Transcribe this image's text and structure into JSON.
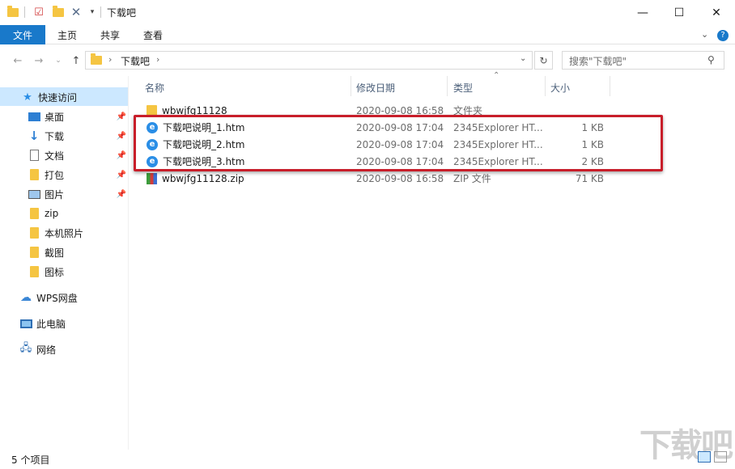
{
  "window": {
    "title": "下载吧",
    "minimize": "—",
    "maximize": "☐",
    "close": "✕"
  },
  "ribbon": {
    "tabs": [
      "文件",
      "主页",
      "共享",
      "查看"
    ],
    "collapse": "⌄",
    "help": "?"
  },
  "address": {
    "path": "下载吧",
    "search_placeholder": "搜索\"下载吧\""
  },
  "nav": {
    "quick_access": "快速访问",
    "items": [
      {
        "label": "桌面",
        "icon": "desktop-icon",
        "pinned": true
      },
      {
        "label": "下载",
        "icon": "download-icon",
        "pinned": true
      },
      {
        "label": "文档",
        "icon": "document-icon",
        "pinned": true
      },
      {
        "label": "打包",
        "icon": "folder-icon",
        "pinned": true
      },
      {
        "label": "图片",
        "icon": "picture-icon",
        "pinned": true
      },
      {
        "label": "zip",
        "icon": "folder-icon",
        "pinned": false
      },
      {
        "label": "本机照片",
        "icon": "folder-icon",
        "pinned": false
      },
      {
        "label": "截图",
        "icon": "folder-icon",
        "pinned": false
      },
      {
        "label": "图标",
        "icon": "folder-icon",
        "pinned": false
      }
    ],
    "wps": "WPS网盘",
    "this_pc": "此电脑",
    "network": "网络"
  },
  "columns": {
    "name": "名称",
    "date": "修改日期",
    "type": "类型",
    "size": "大小"
  },
  "files": [
    {
      "name": "wbwjfg11128",
      "date": "2020-09-08 16:58",
      "type": "文件夹",
      "size": "",
      "icon": "folder-icon"
    },
    {
      "name": "下载吧说明_1.htm",
      "date": "2020-09-08 17:04",
      "type": "2345Explorer HT...",
      "size": "1 KB",
      "icon": "browser-icon"
    },
    {
      "name": "下载吧说明_2.htm",
      "date": "2020-09-08 17:04",
      "type": "2345Explorer HT...",
      "size": "1 KB",
      "icon": "browser-icon"
    },
    {
      "name": "下载吧说明_3.htm",
      "date": "2020-09-08 17:04",
      "type": "2345Explorer HT...",
      "size": "2 KB",
      "icon": "browser-icon"
    },
    {
      "name": "wbwjfg11128.zip",
      "date": "2020-09-08 16:58",
      "type": "ZIP 文件",
      "size": "71 KB",
      "icon": "zip-icon"
    }
  ],
  "status": {
    "count": "5 个项目"
  },
  "watermark": "下载吧"
}
